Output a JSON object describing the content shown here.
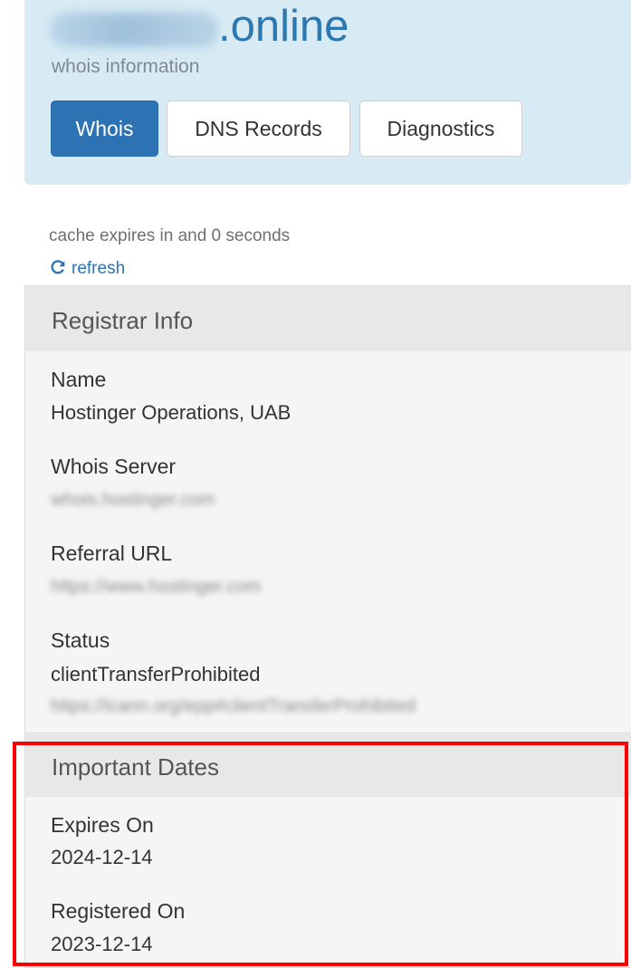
{
  "header": {
    "domain_obscured": "redacted",
    "domain_tld": ".online",
    "subtitle": "whois information",
    "tabs": [
      {
        "label": "Whois",
        "active": true
      },
      {
        "label": "DNS Records",
        "active": false
      },
      {
        "label": "Diagnostics",
        "active": false
      }
    ]
  },
  "cache": {
    "note": "cache expires in and 0 seconds",
    "refresh_label": "refresh",
    "refresh_icon": "refresh-icon"
  },
  "registrar": {
    "title": "Registrar Info",
    "name_label": "Name",
    "name_value": "Hostinger Operations, UAB",
    "whois_server_label": "Whois Server",
    "whois_server_value": "whois.hostinger.com",
    "referral_label": "Referral URL",
    "referral_value": "https://www.hostinger.com",
    "status_label": "Status",
    "status_value": "clientTransferProhibited",
    "status_link": "https://icann.org/epp#clientTransferProhibited"
  },
  "dates": {
    "title": "Important Dates",
    "expires_label": "Expires On",
    "expires_value": "2024-12-14",
    "registered_label": "Registered On",
    "registered_value": "2023-12-14"
  },
  "colors": {
    "accent": "#2d73b4",
    "header_bg": "#d8ebf4",
    "highlight": "#ff0000"
  }
}
